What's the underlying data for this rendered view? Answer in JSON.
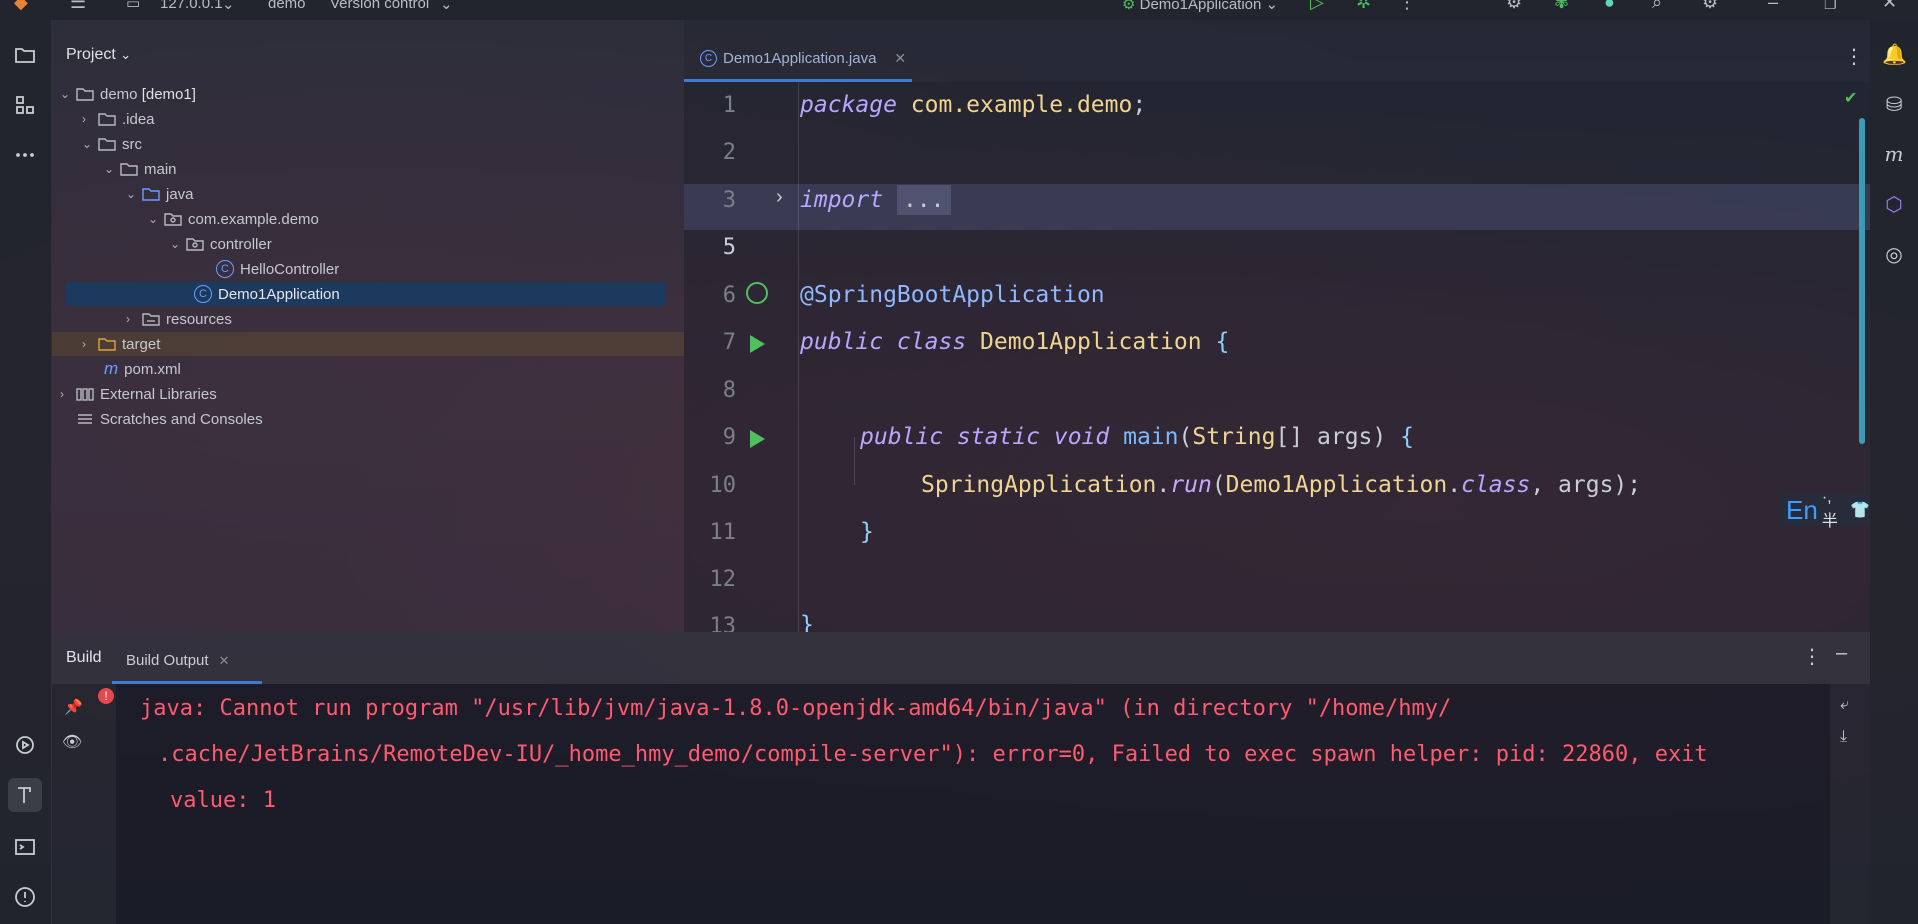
{
  "titlebar": {
    "host": "127.0.0.1",
    "project": "demo",
    "vcs": "Version control",
    "run_config": "Demo1Application"
  },
  "project_panel": {
    "title": "Project",
    "tree": [
      {
        "label": "demo",
        "suffix": "[demo1]"
      },
      {
        "label": ".idea"
      },
      {
        "label": "src"
      },
      {
        "label": "main"
      },
      {
        "label": "java"
      },
      {
        "label": "com.example.demo"
      },
      {
        "label": "controller"
      },
      {
        "label": "HelloController"
      },
      {
        "label": "Demo1Application"
      },
      {
        "label": "resources"
      },
      {
        "label": "target"
      },
      {
        "label": "pom.xml"
      },
      {
        "label": "External Libraries"
      },
      {
        "label": "Scratches and Consoles"
      }
    ]
  },
  "editor": {
    "tab_label": "Demo1Application.java",
    "line_numbers": [
      "1",
      "2",
      "3",
      "5",
      "6",
      "7",
      "8",
      "9",
      "10",
      "11",
      "12",
      "13"
    ],
    "code": {
      "l1_kw": "package",
      "l1_pkg": "com.example.demo",
      "l1_end": ";",
      "l3_kw": "import",
      "l3_fold": "...",
      "l6_ann": "@SpringBootApplication",
      "l7_kw": "public class",
      "l7_cls": "Demo1Application",
      "l7_br": "{",
      "l9_kw": "public static void",
      "l9_fn": "main",
      "l9_p1": "(",
      "l9_type": "String",
      "l9_p2": "[] args) ",
      "l9_br": "{",
      "l10_cls": "SpringApplication",
      "l10_dot": ".",
      "l10_fn": "run",
      "l10_p1": "(",
      "l10_cls2": "Demo1Application",
      "l10_dot2": ".",
      "l10_kw": "class",
      "l10_end": ", args);",
      "l11_br": "}",
      "l13_br": "}"
    },
    "ime_indicator": "En",
    "ime_extra": "·, 半"
  },
  "build": {
    "tab_build": "Build",
    "tab_output": "Build Output",
    "error_lines": [
      "java: Cannot run program \"/usr/lib/jvm/java-1.8.0-openjdk-amd64/bin/java\" (in directory \"/home/hmy/",
      ".cache/JetBrains/RemoteDev-IU/_home_hmy_demo/compile-server\"): error=0, Failed to exec spawn helper: pid: 22860, exit",
      "value: 1"
    ]
  },
  "colors": {
    "accent": "#3d7bd9",
    "error": "#ff5a6e",
    "run_green": "#4fbf60",
    "selection": "#1c3a5e"
  }
}
